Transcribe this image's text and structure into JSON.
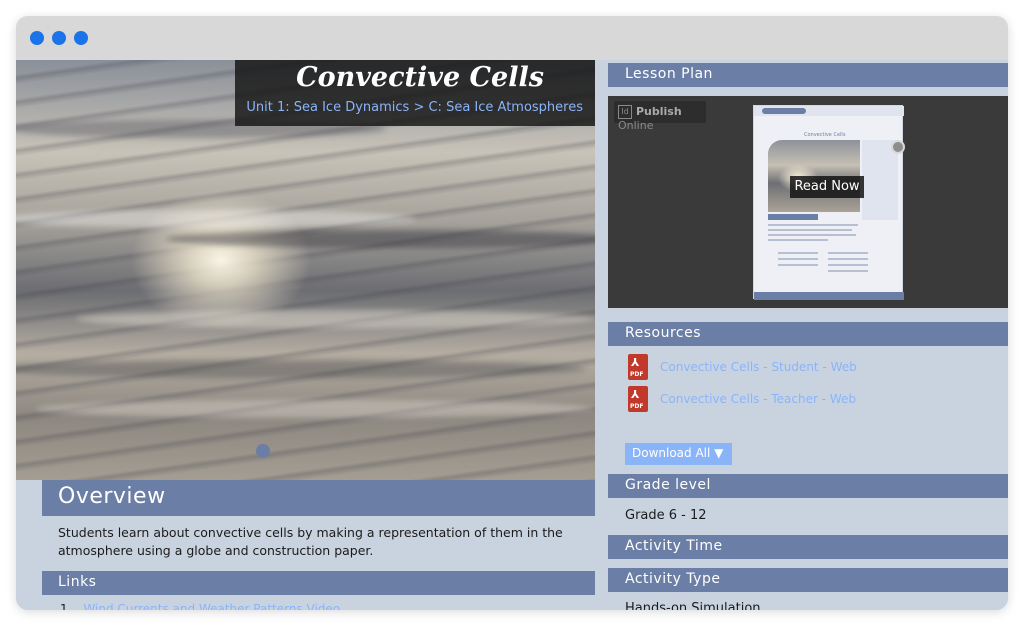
{
  "window": {
    "controls": [
      "window-dot",
      "window-dot",
      "window-dot"
    ]
  },
  "hero": {
    "title": "Convective Cells",
    "breadcrumb": "Unit 1: Sea Ice Dynamics > C: Sea Ice Atmospheres"
  },
  "overview": {
    "heading": "Overview",
    "text": "Students learn about convective cells by making a representation of them in the atmosphere using a globe and construction paper."
  },
  "links": {
    "heading": "Links",
    "items": [
      {
        "num": "1.",
        "label": "Wind Currents and Weather Patterns Video"
      }
    ]
  },
  "lesson_plan": {
    "heading": "Lesson Plan",
    "publish_label": "Publish",
    "publish_suffix": "Online",
    "read_now": "Read Now"
  },
  "resources": {
    "heading": "Resources",
    "items": [
      {
        "icon": "pdf-icon",
        "label": "Convective Cells - Student - Web"
      },
      {
        "icon": "pdf-icon",
        "label": "Convective Cells - Teacher - Web"
      }
    ],
    "download_all": "Download All ▼"
  },
  "grade_level": {
    "heading": "Grade level",
    "value": "Grade 6 - 12"
  },
  "activity_time": {
    "heading": "Activity Time"
  },
  "activity_type": {
    "heading": "Activity Type",
    "value": "Hands-on Simulation"
  },
  "colors": {
    "accent": "#6b7ea6",
    "link": "#8ab4f8",
    "background": "#c9d3e0",
    "window_dot": "#1a73e8"
  }
}
